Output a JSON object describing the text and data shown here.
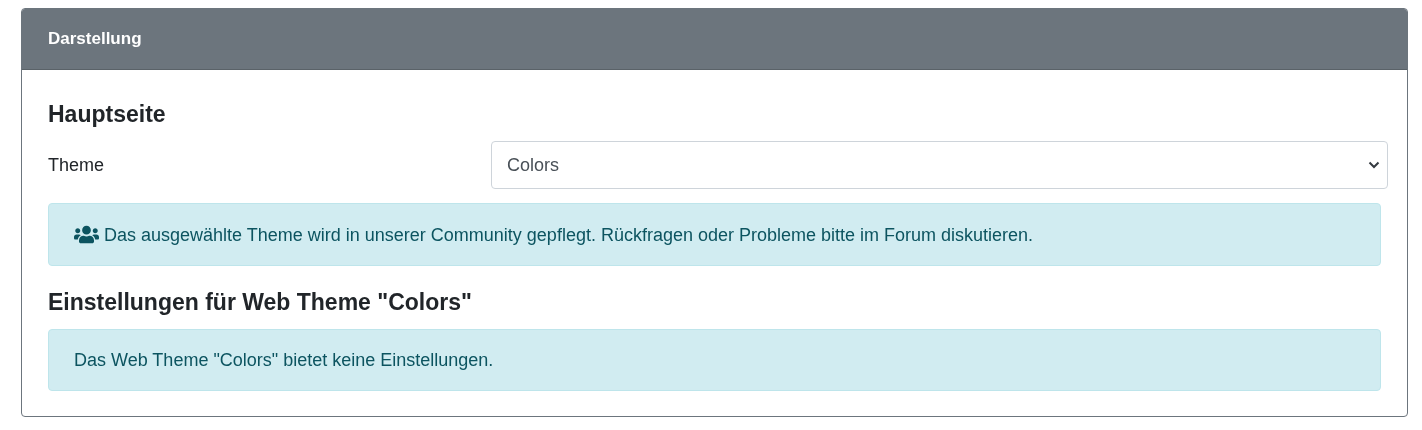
{
  "card": {
    "title": "Darstellung"
  },
  "sections": [
    {
      "heading": "Hauptseite",
      "fields": [
        {
          "label": "Theme",
          "value": "Colors"
        }
      ],
      "alert": {
        "icon": true,
        "text": "Das ausgewählte Theme wird in unserer Community gepflegt. Rückfragen oder Probleme bitte im Forum diskutieren."
      }
    },
    {
      "heading": "Einstellungen für Web Theme \"Colors\"",
      "alert": {
        "icon": false,
        "text": "Das Web Theme \"Colors\" bietet keine Einstellungen."
      }
    }
  ]
}
